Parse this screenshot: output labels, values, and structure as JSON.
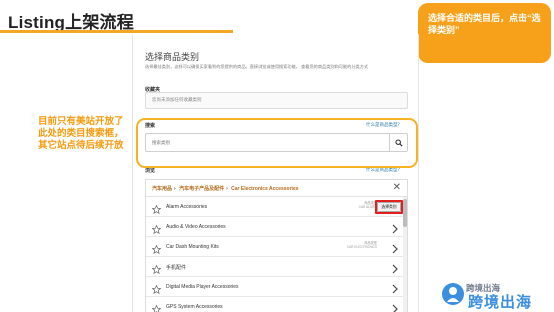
{
  "slide": {
    "title": "Listing上架流程",
    "callout": "选择合适的类目后，点击“选择类别”",
    "left_note": "目前只有美站开放了此处的类目搜索框，其它站点待后续开放"
  },
  "panel": {
    "heading": "选择商品类别",
    "description": "选择最佳类别，这样可以确保买家看到的您提供的商品。直接浏览或使用搜索功能。 查看您的商品类别和可能的分类方式",
    "description_link": "查看现有商品类别中的分类方式",
    "favorites": {
      "label": "收藏夹",
      "placeholder": "您尚未添加任何收藏类别"
    },
    "search": {
      "label": "搜索",
      "help": "什么是商品类型？",
      "placeholder": "搜索类别",
      "button_icon": "search-icon"
    },
    "browse": {
      "label": "浏览",
      "help": "什么是商品类型？",
      "breadcrumb": [
        "汽车用品",
        "汽车电子产品及配件",
        "Car Electronics Accessories"
      ],
      "rows": [
        {
          "label": "Alarm Accessories",
          "meta_line1": "商品类型",
          "meta_line2": "CAR ALARM",
          "action": "选择类别"
        },
        {
          "label": "Audio & Video Accessories"
        },
        {
          "label": "Car Dash Mounting Kits",
          "meta_line1": "商品类型",
          "meta_line2": "CAR ELECTRONICS"
        },
        {
          "label": "手机配件"
        },
        {
          "label": "Digital Media Player Accessories"
        },
        {
          "label": "GPS System Accessories"
        }
      ]
    }
  },
  "watermark": {
    "line1": "跨境出海",
    "line2": "跨境出海"
  },
  "colors": {
    "accent_orange": "#f7a11a",
    "rule_orange": "#f5a623",
    "highlight_red": "#e02020",
    "link_blue": "#2a7ab0",
    "crumb_orange": "#b8691b"
  }
}
